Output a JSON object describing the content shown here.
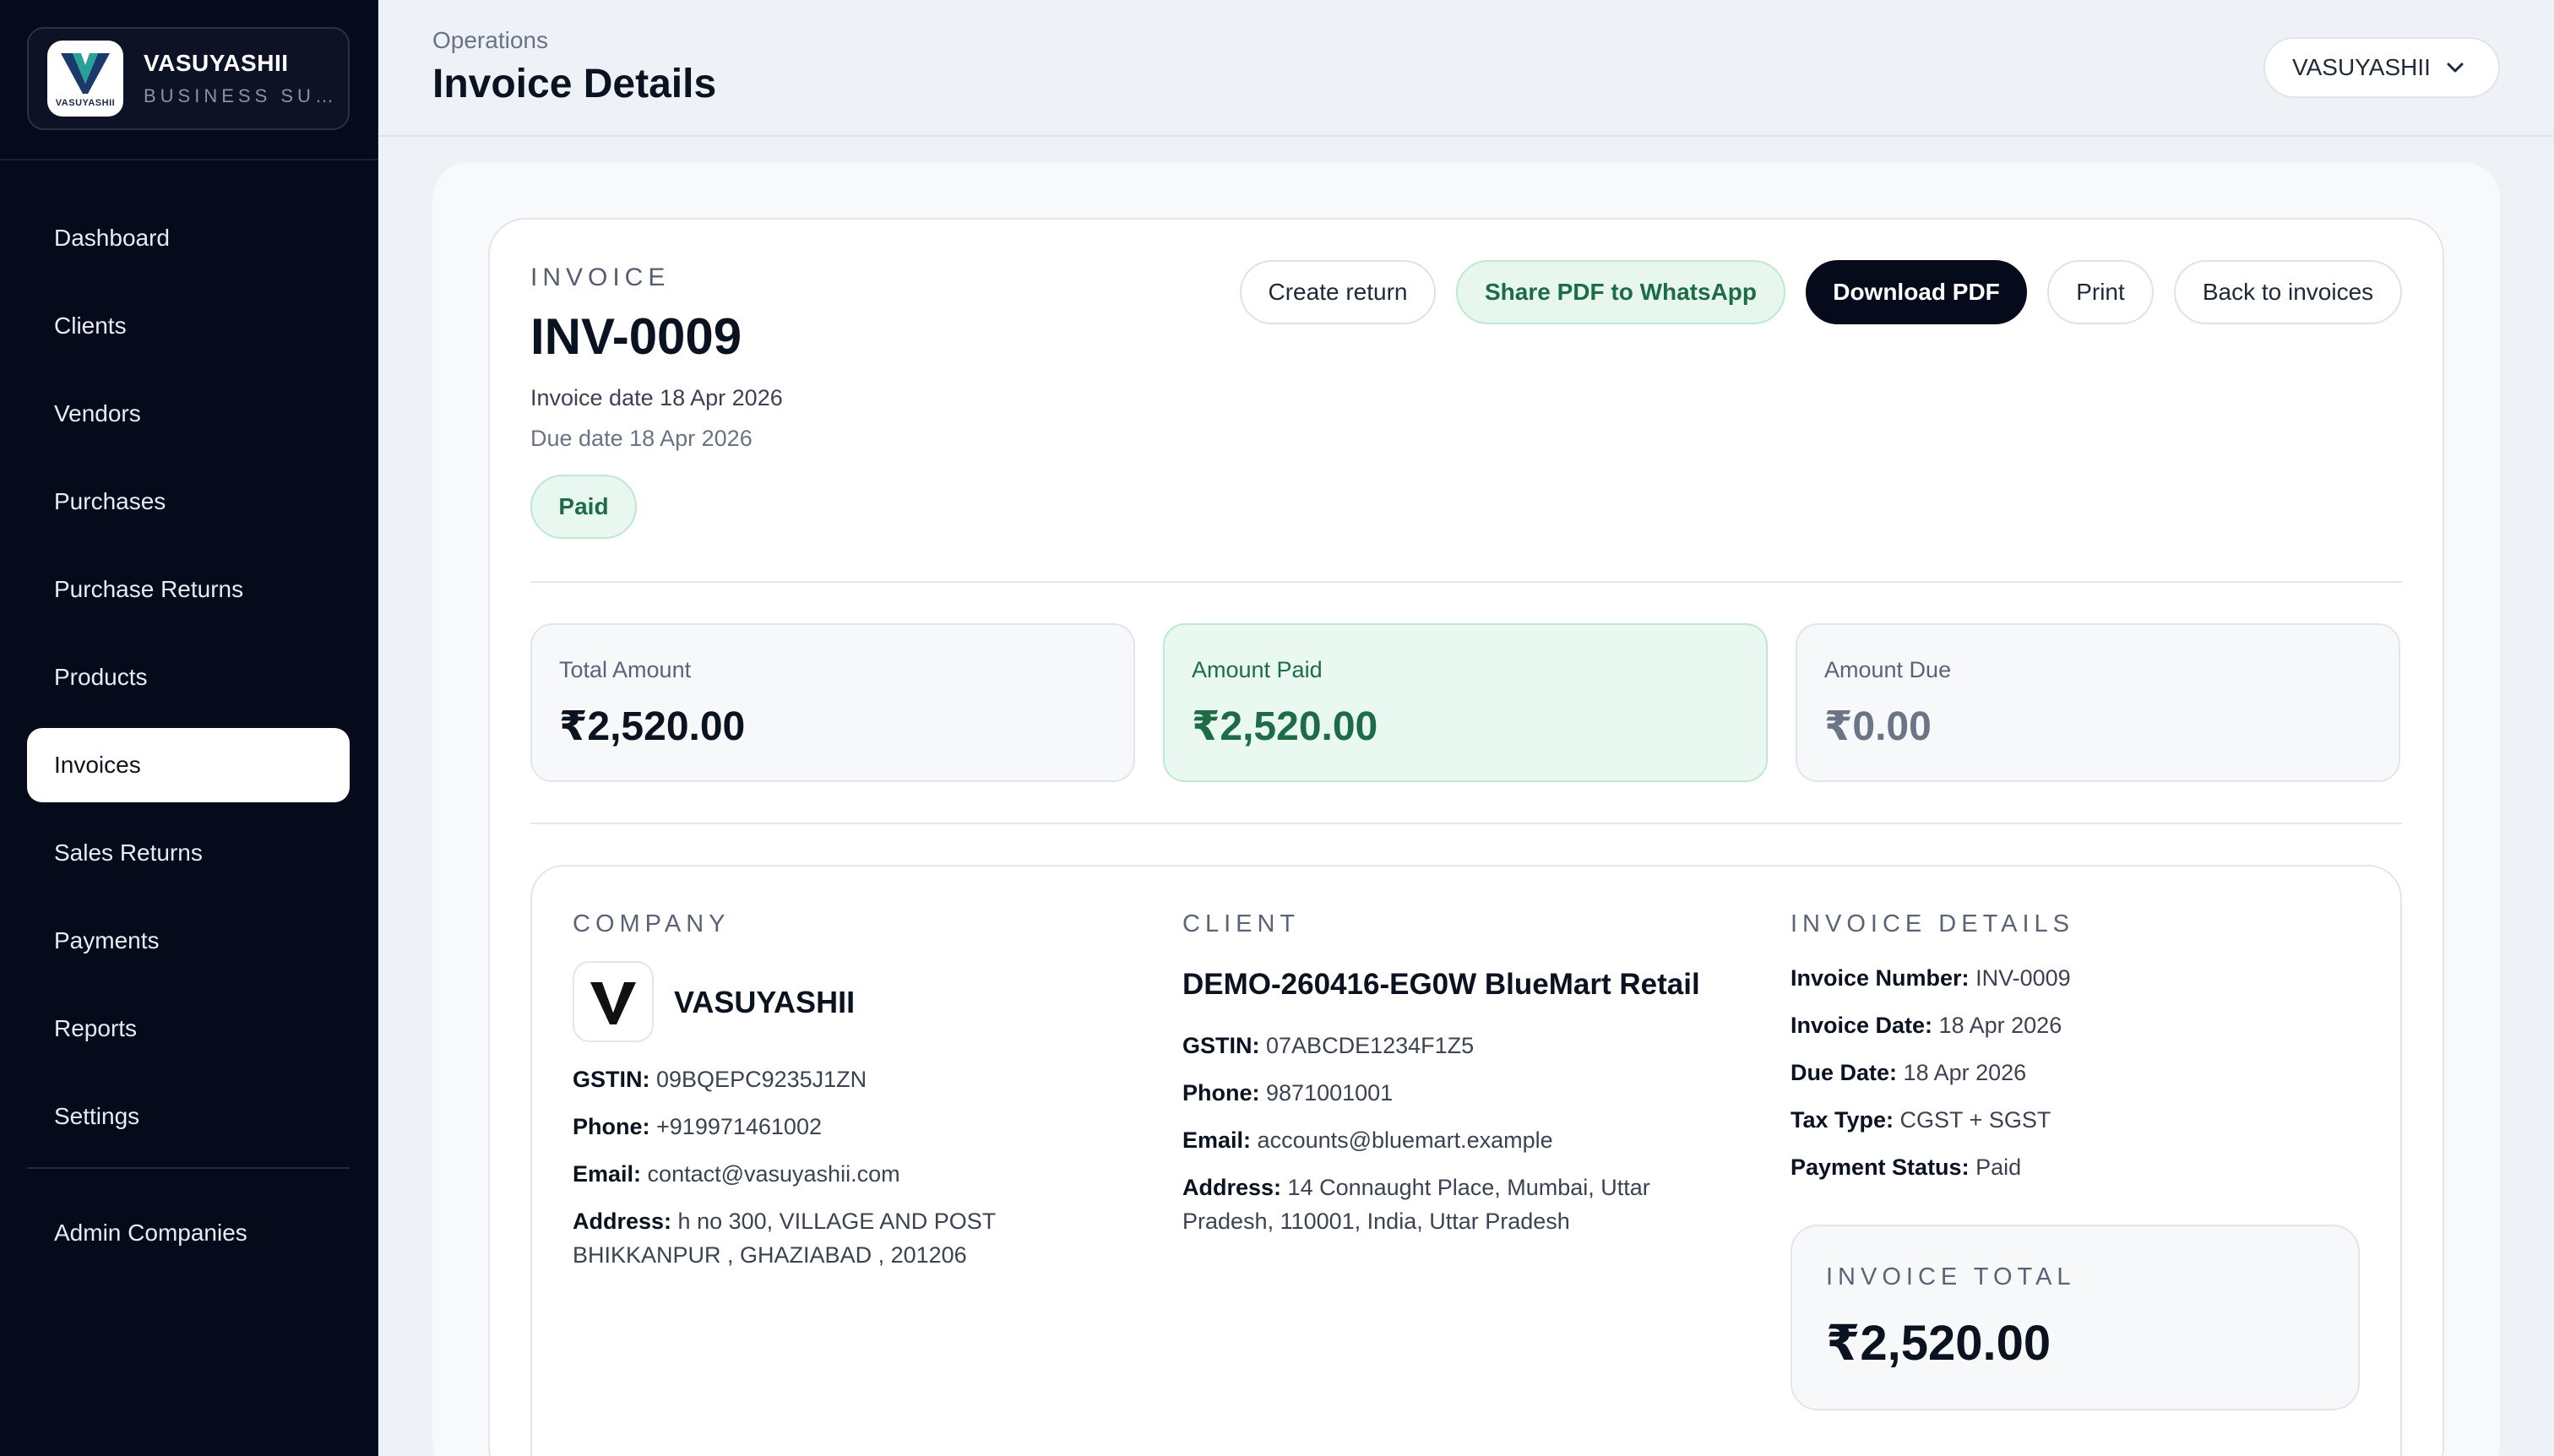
{
  "brand": {
    "name": "VASUYASHII",
    "subtitle": "BUSINESS SUITE",
    "logo_text": "VASUYASHII"
  },
  "sidebar": {
    "items": [
      {
        "label": "Dashboard"
      },
      {
        "label": "Clients"
      },
      {
        "label": "Vendors"
      },
      {
        "label": "Purchases"
      },
      {
        "label": "Purchase Returns"
      },
      {
        "label": "Products"
      },
      {
        "label": "Invoices",
        "active": true
      },
      {
        "label": "Sales Returns"
      },
      {
        "label": "Payments"
      },
      {
        "label": "Reports"
      },
      {
        "label": "Settings"
      }
    ],
    "admin": {
      "label": "Admin Companies"
    }
  },
  "header": {
    "breadcrumb": "Operations",
    "title": "Invoice Details",
    "company_switcher": {
      "value": "VASUYASHII",
      "icon": "chevron-down-icon"
    }
  },
  "invoice": {
    "label": "INVOICE",
    "number": "INV-0009",
    "invoice_date_text": "Invoice date 18 Apr 2026",
    "due_date_text": "Due date 18 Apr 2026",
    "status": "Paid"
  },
  "actions": {
    "create_return": "Create return",
    "share_whatsapp": "Share PDF to WhatsApp",
    "download_pdf": "Download PDF",
    "print": "Print",
    "back": "Back to invoices"
  },
  "stats": {
    "total": {
      "label": "Total Amount",
      "value": "₹2,520.00"
    },
    "paid": {
      "label": "Amount Paid",
      "value": "₹2,520.00"
    },
    "due": {
      "label": "Amount Due",
      "value": "₹0.00"
    }
  },
  "company": {
    "title": "COMPANY",
    "name": "VASUYASHII",
    "gstin_label": "GSTIN:",
    "gstin": "09BQEPC9235J1ZN",
    "phone_label": "Phone:",
    "phone": "+919971461002",
    "email_label": "Email:",
    "email": "contact@vasuyashii.com",
    "address_label": "Address:",
    "address_line1": "h no 300, VILLAGE AND POST",
    "address_line2": "BHIKKANPUR , GHAZIABAD , 201206"
  },
  "client": {
    "title": "CLIENT",
    "name": "DEMO-260416-EG0W BlueMart Retail",
    "gstin_label": "GSTIN:",
    "gstin": "07ABCDE1234F1Z5",
    "phone_label": "Phone:",
    "phone": "9871001001",
    "email_label": "Email:",
    "email": "accounts@bluemart.example",
    "address_label": "Address:",
    "address_line1": "14 Connaught Place, Mumbai, Uttar",
    "address_line2": "Pradesh, 110001, India, Uttar Pradesh"
  },
  "details": {
    "title": "INVOICE DETAILS",
    "number_label": "Invoice Number:",
    "number": "INV-0009",
    "date_label": "Invoice Date:",
    "date": "18 Apr 2026",
    "due_label": "Due Date:",
    "due": "18 Apr 2026",
    "tax_label": "Tax Type:",
    "tax": "CGST + SGST",
    "status_label": "Payment Status:",
    "status": "Paid",
    "total_label": "INVOICE TOTAL",
    "total_value": "₹2,520.00"
  },
  "colors": {
    "sidebar_bg": "#060b1c",
    "accent_green": "#1d6b47",
    "green_bg": "#e9f8f0",
    "primary_button": "#060b1c"
  }
}
